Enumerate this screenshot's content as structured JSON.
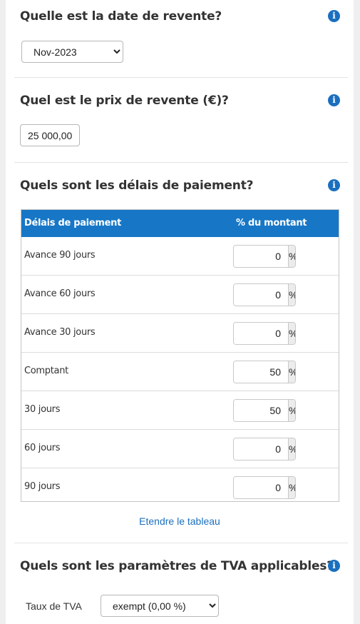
{
  "resale_date": {
    "question": "Quelle est la date de revente?",
    "selected": "Nov-2023"
  },
  "resale_price": {
    "question": "Quel est le prix de revente (€)?",
    "value": "25 000,00"
  },
  "payment_terms": {
    "question": "Quels sont les délais de paiement?",
    "columns": [
      "Délais de paiement",
      "% du montant"
    ],
    "rows": [
      {
        "label": "Avance 90 jours",
        "value": "0",
        "unit": "%"
      },
      {
        "label": "Avance 60 jours",
        "value": "0",
        "unit": "%"
      },
      {
        "label": "Avance 30 jours",
        "value": "0",
        "unit": "%"
      },
      {
        "label": "Comptant",
        "value": "50",
        "unit": "%"
      },
      {
        "label": "30 jours",
        "value": "50",
        "unit": "%"
      },
      {
        "label": "60 jours",
        "value": "0",
        "unit": "%"
      },
      {
        "label": "90 jours",
        "value": "0",
        "unit": "%"
      }
    ],
    "expand_link": "Etendre le tableau"
  },
  "vat": {
    "question": "Quels sont les paramètres de TVA applicables?",
    "rate_label": "Taux de TVA",
    "rate_selected": "exempt (0,00 %)"
  },
  "icons": {
    "info": "info-icon",
    "dropdown": "chevron-down-icon"
  },
  "colors": {
    "header_bg": "#1777c6",
    "link": "#1a6fbf",
    "info_icon": "#1a6fbf"
  }
}
